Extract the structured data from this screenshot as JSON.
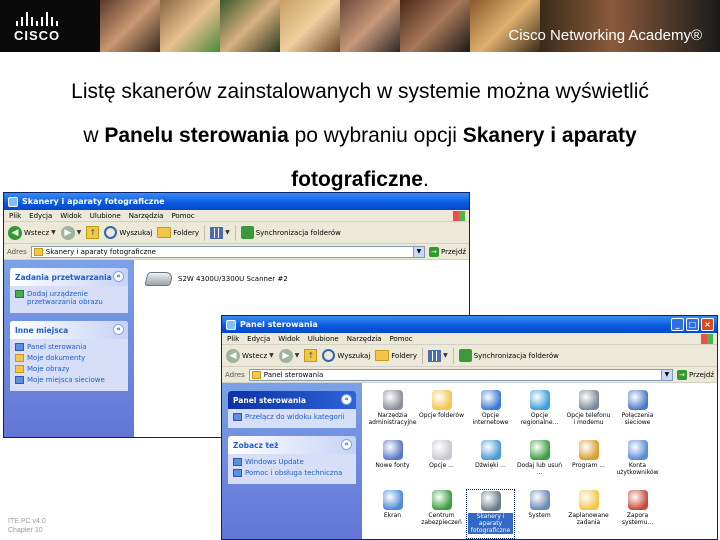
{
  "banner": {
    "logo_text": "CISCO",
    "academy_text": "Cisco Networking Academy®",
    "background": "#0a0a0a"
  },
  "slide": {
    "line1": "Listę skanerów zainstalowanych w systemie można wyświetlić",
    "line2_a": "w ",
    "line2_b": "Panelu sterowania",
    "line2_c": " po wybraniu opcji ",
    "line2_d": "Skanery i aparaty",
    "line3_a": "fotograficzne",
    "line3_b": "."
  },
  "footer": {
    "line1": "ITE PC v4.0",
    "line2": "Chapter 10"
  },
  "scanners_window": {
    "title": "Skanery i aparaty fotograficzne",
    "menu": [
      "Plik",
      "Edycja",
      "Widok",
      "Ulubione",
      "Narzędzia",
      "Pomoc"
    ],
    "toolbar": {
      "back": "Wstecz",
      "search": "Wyszukaj",
      "folders": "Foldery",
      "sync": "Synchronizacja folderów"
    },
    "address_label": "Adres",
    "address_value": "Skanery i aparaty fotograficzne",
    "go_label": "Przejdź",
    "task_panel": {
      "title": "Zadania przetwarzania o",
      "items": [
        "Dodaj urządzenie przetwarzania obrazu"
      ]
    },
    "other_places": {
      "title": "Inne miejsca",
      "items": [
        "Panel sterowania",
        "Moje dokumenty",
        "Moje obrazy",
        "Moje miejsca sieciowe"
      ]
    },
    "scanner_label": "S2W 4300U/3300U Scanner #2"
  },
  "control_panel_window": {
    "title": "Panel sterowania",
    "menu": [
      "Plik",
      "Edycja",
      "Widok",
      "Ulubione",
      "Narzędzia",
      "Pomoc"
    ],
    "toolbar": {
      "back": "Wstecz",
      "search": "Wyszukaj",
      "folders": "Foldery",
      "sync": "Synchronizacja folderów"
    },
    "address_label": "Adres",
    "address_value": "Panel sterowania",
    "go_label": "Przejdź",
    "panel_box": {
      "title": "Panel sterowania",
      "items": [
        "Przełącz do widoku kategorii"
      ]
    },
    "see_also": {
      "title": "Zobacz też",
      "items": [
        "Windows Update",
        "Pomoc i obsługa techniczna"
      ]
    },
    "icons": [
      {
        "label": "Narzędzia administracyjne",
        "color": "#8a8f99"
      },
      {
        "label": "Opcje folderów",
        "color": "#f3c64a"
      },
      {
        "label": "Opcje internetowe",
        "color": "#3a7ad8"
      },
      {
        "label": "Opcje regionalne...",
        "color": "#3aa0d8"
      },
      {
        "label": "Opcje telefonu i modemu",
        "color": "#7a8a9a"
      },
      {
        "label": "Połączenia sieciowe",
        "color": "#4a7ac8"
      },
      {
        "label": "Nowe fonty",
        "color": "#5a78c8"
      },
      {
        "label": "Opcje ... ",
        "color": "#c8c8d0"
      },
      {
        "label": "Dźwięki ...",
        "color": "#4a9ad8"
      },
      {
        "label": "Dodaj lub usuń ...",
        "color": "#3aa040"
      },
      {
        "label": "Program ...",
        "color": "#d8a030"
      },
      {
        "label": "Konta użytkowników",
        "color": "#5a8ad8"
      },
      {
        "label": "Ekran",
        "color": "#4a8ad8"
      },
      {
        "label": "Centrum zabezpieczeń",
        "color": "#3aa040"
      },
      {
        "label": "Skanery i aparaty fotograficzne",
        "color": "#6a7a8a"
      },
      {
        "label": "System",
        "color": "#6a8ab8"
      },
      {
        "label": "Zaplanowane zadania",
        "color": "#f3c64a"
      },
      {
        "label": "Zapora systemu...",
        "color": "#c84a3a"
      }
    ],
    "selected_icon": "Skanery i aparaty fotograficzne"
  },
  "colors": {
    "xp_title": "#0858e0",
    "xp_taskpane": "#7ba2e7",
    "selection": "#316ac5"
  }
}
